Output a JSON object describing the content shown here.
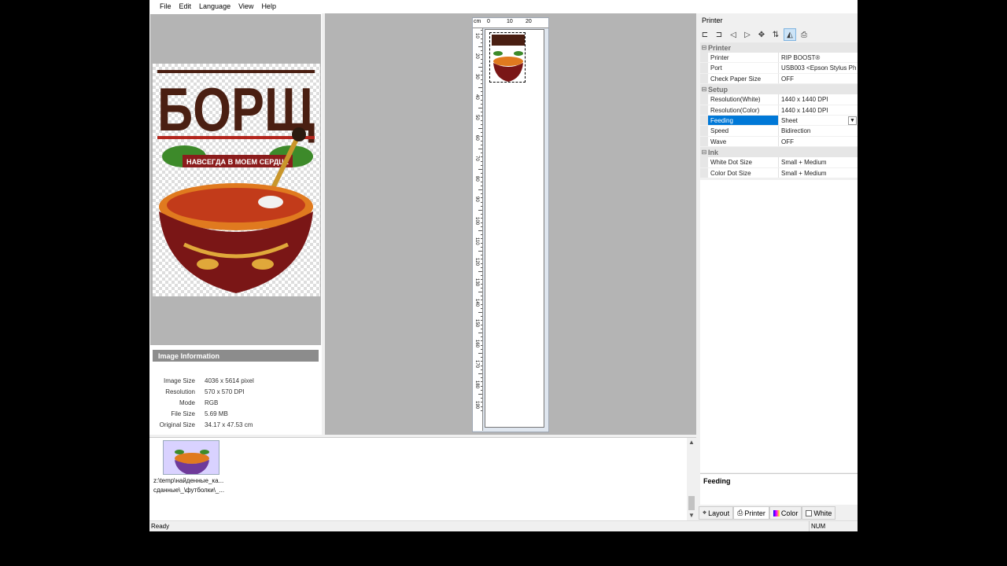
{
  "menu": [
    "File",
    "Edit",
    "Language",
    "View",
    "Help"
  ],
  "preview": {
    "art_title": "БОРЩ",
    "art_banner": "НАВСЕГДА В МОЕМ СЕРДЦЕ"
  },
  "image_info": {
    "header": "Image Information",
    "rows": [
      {
        "label": "Image Size",
        "value": "4036 x 5614 pixel"
      },
      {
        "label": "Resolution",
        "value": "570 x 570 DPI"
      },
      {
        "label": "Mode",
        "value": "RGB"
      },
      {
        "label": "File Size",
        "value": "5.69 MB"
      },
      {
        "label": "Original Size",
        "value": "34.17 x 47.53 cm"
      }
    ]
  },
  "ruler": {
    "unit": "cm",
    "top_labels": [
      "0",
      "10",
      "20"
    ],
    "left_labels": [
      "10",
      "20",
      "30",
      "40",
      "50",
      "60",
      "70",
      "80",
      "90",
      "100",
      "110",
      "120",
      "130",
      "140",
      "150",
      "160",
      "170",
      "180",
      "190"
    ]
  },
  "properties": {
    "title": "Printer",
    "categories": [
      {
        "name": "Printer",
        "rows": [
          {
            "name": "Printer",
            "value": "RIP BOOST®"
          },
          {
            "name": "Port",
            "value": "USB003  <Epson Stylus Ph"
          },
          {
            "name": "Check Paper Size",
            "value": "OFF"
          }
        ]
      },
      {
        "name": "Setup",
        "rows": [
          {
            "name": "Resolution(White)",
            "value": "1440 x 1440 DPI"
          },
          {
            "name": "Resolution(Color)",
            "value": "1440 x 1440 DPI"
          },
          {
            "name": "Feeding",
            "value": "Sheet"
          },
          {
            "name": "Speed",
            "value": "Bidirection"
          },
          {
            "name": "Wave",
            "value": "OFF"
          }
        ]
      },
      {
        "name": "Ink",
        "rows": [
          {
            "name": "White Dot Size",
            "value": "Small + Medium"
          },
          {
            "name": "Color Dot Size",
            "value": "Small + Medium"
          }
        ]
      }
    ],
    "description": "Feeding"
  },
  "bottom_tabs": [
    {
      "icon": "layout-icon",
      "label": "Layout"
    },
    {
      "icon": "printer-icon",
      "label": "Printer"
    },
    {
      "icon": "color-icon",
      "label": "Color"
    },
    {
      "icon": "white-icon",
      "label": "White"
    }
  ],
  "thumbnail": {
    "caption_line1": "z:\\temp\\найденные_ка...",
    "caption_line2": "сданные\\_\\футболки\\_..."
  },
  "status": {
    "text": "Ready",
    "num": "NUM"
  },
  "colors": {
    "selection": "#0078d7",
    "canvas_bg": "#b4b4b4",
    "art_brown": "#4a1f12",
    "art_red": "#b3261e"
  }
}
